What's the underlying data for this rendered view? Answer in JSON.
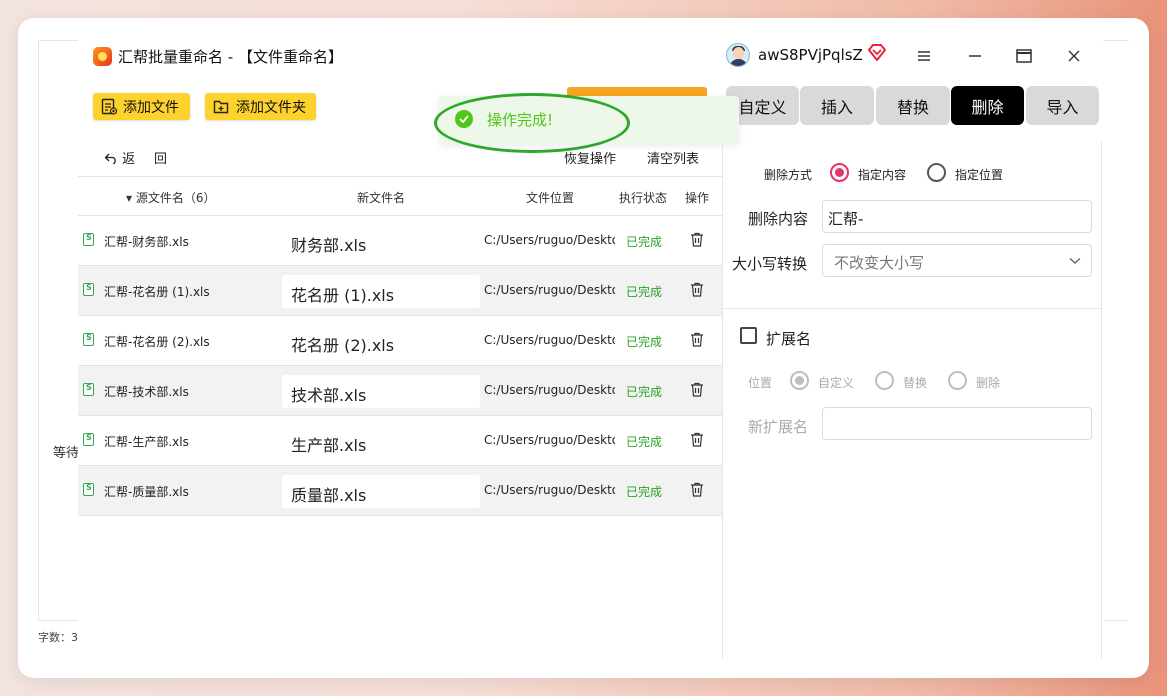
{
  "background": {
    "side_text": "等待",
    "footer_text": "字数：3"
  },
  "title_bar": {
    "title": "汇帮批量重命名 - 【文件重命名】",
    "username": "awS8PVjPqlsZ"
  },
  "toolbar": {
    "add_file": "添加文件",
    "add_folder": "添加文件夹"
  },
  "toast": {
    "message": "操作完成!"
  },
  "list_actions": {
    "back": "返",
    "redo": "回",
    "restore": "恢复操作",
    "clear": "清空列表"
  },
  "table": {
    "headers": {
      "source": "源文件名（6）",
      "new_name": "新文件名",
      "location": "文件位置",
      "status": "执行状态",
      "action": "操作"
    },
    "rows": [
      {
        "source": "汇帮-财务部.xls",
        "new_name": "财务部.xls",
        "location": "C:/Users/ruguo/Deskto",
        "status": "已完成"
      },
      {
        "source": "汇帮-花名册 (1).xls",
        "new_name": "花名册 (1).xls",
        "location": "C:/Users/ruguo/Deskto",
        "status": "已完成"
      },
      {
        "source": "汇帮-花名册 (2).xls",
        "new_name": "花名册 (2).xls",
        "location": "C:/Users/ruguo/Deskto",
        "status": "已完成"
      },
      {
        "source": "汇帮-技术部.xls",
        "new_name": "技术部.xls",
        "location": "C:/Users/ruguo/Deskto",
        "status": "已完成"
      },
      {
        "source": "汇帮-生产部.xls",
        "new_name": "生产部.xls",
        "location": "C:/Users/ruguo/Deskto",
        "status": "已完成"
      },
      {
        "source": "汇帮-质量部.xls",
        "new_name": "质量部.xls",
        "location": "C:/Users/ruguo/Deskto",
        "status": "已完成"
      }
    ]
  },
  "tabs": [
    "自定义",
    "插入",
    "替换",
    "删除",
    "导入"
  ],
  "active_tab": "删除",
  "delete_panel": {
    "mode_label": "删除方式",
    "mode_specified_content": "指定内容",
    "mode_specified_position": "指定位置",
    "content_label": "删除内容",
    "content_value": "汇帮-",
    "case_label": "大小写转换",
    "case_value": "不改变大小写",
    "extension_label": "扩展名",
    "position_label": "位置",
    "pos_custom": "自定义",
    "pos_replace": "替换",
    "pos_delete": "删除",
    "new_ext_label": "新扩展名",
    "new_ext_value": ""
  },
  "colors": {
    "accent_yellow": "#fdd22c",
    "status_green": "#27a327",
    "radio_pink": "#e8336a",
    "toast_ring": "#2ea82a"
  }
}
